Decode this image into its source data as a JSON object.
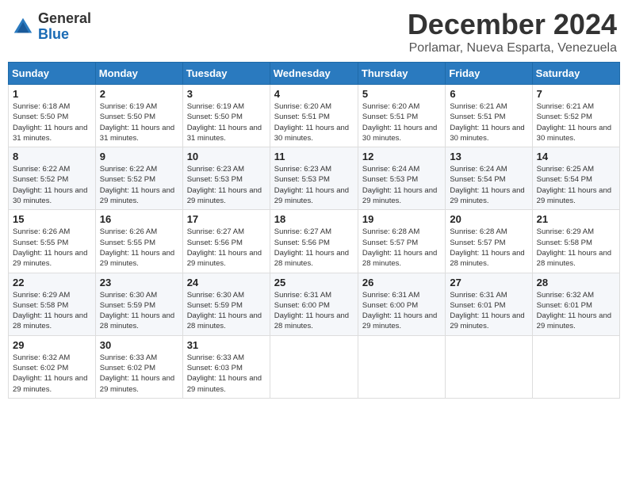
{
  "logo": {
    "general": "General",
    "blue": "Blue"
  },
  "header": {
    "month": "December 2024",
    "location": "Porlamar, Nueva Esparta, Venezuela"
  },
  "weekdays": [
    "Sunday",
    "Monday",
    "Tuesday",
    "Wednesday",
    "Thursday",
    "Friday",
    "Saturday"
  ],
  "weeks": [
    [
      {
        "day": "1",
        "sunrise": "6:18 AM",
        "sunset": "5:50 PM",
        "daylight": "11 hours and 31 minutes."
      },
      {
        "day": "2",
        "sunrise": "6:19 AM",
        "sunset": "5:50 PM",
        "daylight": "11 hours and 31 minutes."
      },
      {
        "day": "3",
        "sunrise": "6:19 AM",
        "sunset": "5:50 PM",
        "daylight": "11 hours and 31 minutes."
      },
      {
        "day": "4",
        "sunrise": "6:20 AM",
        "sunset": "5:51 PM",
        "daylight": "11 hours and 30 minutes."
      },
      {
        "day": "5",
        "sunrise": "6:20 AM",
        "sunset": "5:51 PM",
        "daylight": "11 hours and 30 minutes."
      },
      {
        "day": "6",
        "sunrise": "6:21 AM",
        "sunset": "5:51 PM",
        "daylight": "11 hours and 30 minutes."
      },
      {
        "day": "7",
        "sunrise": "6:21 AM",
        "sunset": "5:52 PM",
        "daylight": "11 hours and 30 minutes."
      }
    ],
    [
      {
        "day": "8",
        "sunrise": "6:22 AM",
        "sunset": "5:52 PM",
        "daylight": "11 hours and 30 minutes."
      },
      {
        "day": "9",
        "sunrise": "6:22 AM",
        "sunset": "5:52 PM",
        "daylight": "11 hours and 29 minutes."
      },
      {
        "day": "10",
        "sunrise": "6:23 AM",
        "sunset": "5:53 PM",
        "daylight": "11 hours and 29 minutes."
      },
      {
        "day": "11",
        "sunrise": "6:23 AM",
        "sunset": "5:53 PM",
        "daylight": "11 hours and 29 minutes."
      },
      {
        "day": "12",
        "sunrise": "6:24 AM",
        "sunset": "5:53 PM",
        "daylight": "11 hours and 29 minutes."
      },
      {
        "day": "13",
        "sunrise": "6:24 AM",
        "sunset": "5:54 PM",
        "daylight": "11 hours and 29 minutes."
      },
      {
        "day": "14",
        "sunrise": "6:25 AM",
        "sunset": "5:54 PM",
        "daylight": "11 hours and 29 minutes."
      }
    ],
    [
      {
        "day": "15",
        "sunrise": "6:26 AM",
        "sunset": "5:55 PM",
        "daylight": "11 hours and 29 minutes."
      },
      {
        "day": "16",
        "sunrise": "6:26 AM",
        "sunset": "5:55 PM",
        "daylight": "11 hours and 29 minutes."
      },
      {
        "day": "17",
        "sunrise": "6:27 AM",
        "sunset": "5:56 PM",
        "daylight": "11 hours and 29 minutes."
      },
      {
        "day": "18",
        "sunrise": "6:27 AM",
        "sunset": "5:56 PM",
        "daylight": "11 hours and 28 minutes."
      },
      {
        "day": "19",
        "sunrise": "6:28 AM",
        "sunset": "5:57 PM",
        "daylight": "11 hours and 28 minutes."
      },
      {
        "day": "20",
        "sunrise": "6:28 AM",
        "sunset": "5:57 PM",
        "daylight": "11 hours and 28 minutes."
      },
      {
        "day": "21",
        "sunrise": "6:29 AM",
        "sunset": "5:58 PM",
        "daylight": "11 hours and 28 minutes."
      }
    ],
    [
      {
        "day": "22",
        "sunrise": "6:29 AM",
        "sunset": "5:58 PM",
        "daylight": "11 hours and 28 minutes."
      },
      {
        "day": "23",
        "sunrise": "6:30 AM",
        "sunset": "5:59 PM",
        "daylight": "11 hours and 28 minutes."
      },
      {
        "day": "24",
        "sunrise": "6:30 AM",
        "sunset": "5:59 PM",
        "daylight": "11 hours and 28 minutes."
      },
      {
        "day": "25",
        "sunrise": "6:31 AM",
        "sunset": "6:00 PM",
        "daylight": "11 hours and 28 minutes."
      },
      {
        "day": "26",
        "sunrise": "6:31 AM",
        "sunset": "6:00 PM",
        "daylight": "11 hours and 29 minutes."
      },
      {
        "day": "27",
        "sunrise": "6:31 AM",
        "sunset": "6:01 PM",
        "daylight": "11 hours and 29 minutes."
      },
      {
        "day": "28",
        "sunrise": "6:32 AM",
        "sunset": "6:01 PM",
        "daylight": "11 hours and 29 minutes."
      }
    ],
    [
      {
        "day": "29",
        "sunrise": "6:32 AM",
        "sunset": "6:02 PM",
        "daylight": "11 hours and 29 minutes."
      },
      {
        "day": "30",
        "sunrise": "6:33 AM",
        "sunset": "6:02 PM",
        "daylight": "11 hours and 29 minutes."
      },
      {
        "day": "31",
        "sunrise": "6:33 AM",
        "sunset": "6:03 PM",
        "daylight": "11 hours and 29 minutes."
      },
      null,
      null,
      null,
      null
    ]
  ],
  "labels": {
    "sunrise": "Sunrise: ",
    "sunset": "Sunset: ",
    "daylight": "Daylight: "
  }
}
